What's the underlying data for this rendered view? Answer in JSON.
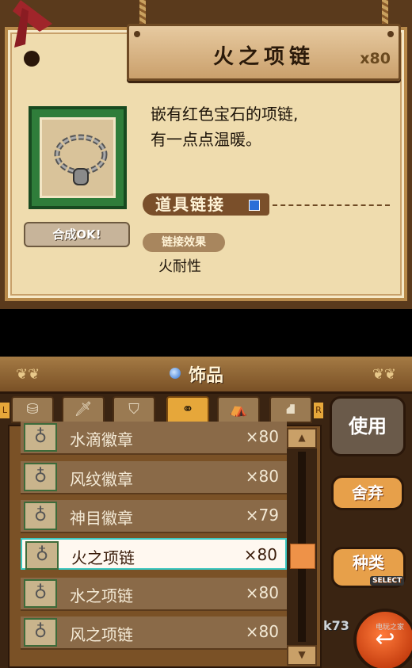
{
  "top": {
    "item_title": "火之项链",
    "item_count": "x80",
    "description_line1": "嵌有红色宝石的项链,",
    "description_line2": "有一点点温暖。",
    "merge_button": "合成OK!",
    "link_label": "道具链接",
    "effect_label": "链接效果",
    "effect_value": "火耐性"
  },
  "bottom": {
    "header_title": "饰品",
    "tabs": [
      {
        "icon": "⛁",
        "name": "tab-barrel"
      },
      {
        "icon": "🗡",
        "name": "tab-weapon"
      },
      {
        "icon": "⛉",
        "name": "tab-shield"
      },
      {
        "icon": "⚭",
        "name": "tab-accessory"
      },
      {
        "icon": "⛺",
        "name": "tab-cauldron"
      },
      {
        "icon": "⛘",
        "name": "tab-chest"
      }
    ],
    "tab_left_arrow": "L",
    "tab_right_arrow": "R",
    "rows": [
      {
        "name": "水滴徽章",
        "qty": "×80"
      },
      {
        "name": "风纹徽章",
        "qty": "×80"
      },
      {
        "name": "神目徽章",
        "qty": "×79"
      },
      {
        "name": "火之项链",
        "qty": "×80"
      },
      {
        "name": "水之项链",
        "qty": "×80"
      },
      {
        "name": "风之项链",
        "qty": "×80"
      }
    ],
    "selected_index": 3,
    "use_button": "使用",
    "discard_button": "舍弃",
    "kind_button": "种类",
    "kind_sub": "SELECT",
    "watermark": "k73",
    "watermark_sub": "电玩之家"
  }
}
